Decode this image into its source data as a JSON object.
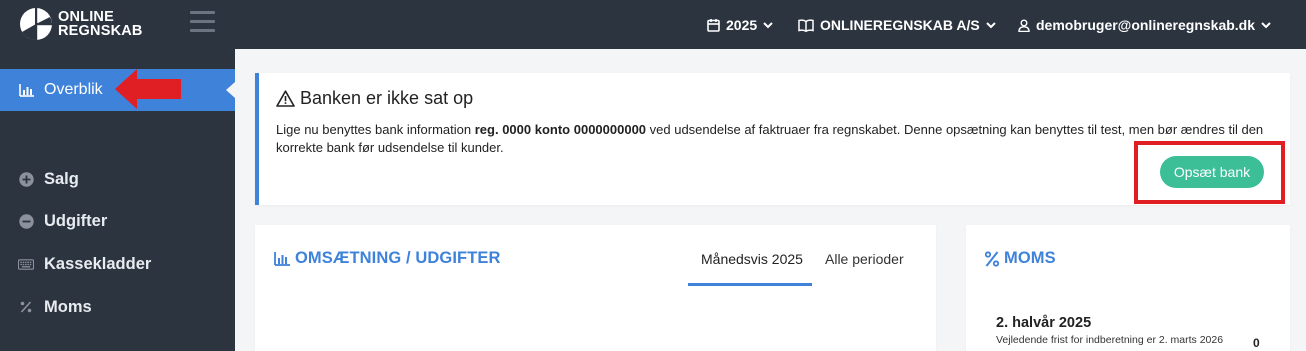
{
  "app": {
    "logo_line1": "ONLINE",
    "logo_line2": "REGNSKAB"
  },
  "topnav": {
    "year": "2025",
    "company": "ONLINEREGNSKAB A/S",
    "user": "demobruger@onlineregnskab.dk"
  },
  "sidebar": {
    "active": {
      "label": "Overblik",
      "icon": "bar-chart-icon"
    },
    "items": [
      {
        "label": "Salg",
        "icon": "plus-circle-icon"
      },
      {
        "label": "Udgifter",
        "icon": "minus-circle-icon"
      },
      {
        "label": "Kassekladder",
        "icon": "keyboard-icon"
      },
      {
        "label": "Moms",
        "icon": "percent-icon"
      }
    ]
  },
  "alert": {
    "title": "Banken er ikke sat op",
    "text_part1": "Lige nu benyttes bank information ",
    "text_bold": "reg. 0000 konto 0000000000",
    "text_part2": " ved udsendelse af faktruaer fra regnskabet. Denne opsætning kan benyttes til test, men bør ændres til den korrekte bank før udsendelse til kunder.",
    "button": "Opsæt bank"
  },
  "turnover_card": {
    "title": "OMSÆTNING / UDGIFTER",
    "tabs": [
      "Månedsvis 2025",
      "Alle perioder"
    ],
    "active_tab": "Månedsvis 2025"
  },
  "moms_card": {
    "title": "MOMS",
    "period": "2. halvår 2025",
    "deadline": "Vejledende frist for indberetning er 2. marts 2026",
    "value": "0"
  },
  "colors": {
    "topbar": "#2c3440",
    "accent": "#3e82da",
    "button": "#3cbf96",
    "annotation_red": "#e01f24"
  }
}
